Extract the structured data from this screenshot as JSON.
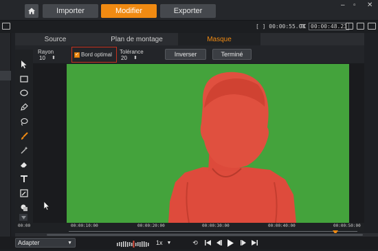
{
  "header": {
    "tabs": [
      {
        "label": "Importer"
      },
      {
        "label": "Modifier"
      },
      {
        "label": "Exporter"
      }
    ]
  },
  "timecode": {
    "duration": "[ ] 00:00:55.08",
    "tc_label": "TC",
    "current": "00:00:48.23"
  },
  "editor_tabs": [
    {
      "label": "Source"
    },
    {
      "label": "Plan de montage"
    },
    {
      "label": "Masque"
    }
  ],
  "options": {
    "radius_label": "Rayon",
    "radius_value": "10",
    "edge_label": "Bord optimal",
    "tolerance_label": "Tolérance",
    "tolerance_value": "20",
    "invert_label": "Inverser",
    "done_label": "Terminé"
  },
  "ruler": {
    "labels": [
      "00:00",
      "00:00:10:00",
      "00:00:20:00",
      "00:00:30:00",
      "00:00:40:00",
      "00:00:50:00"
    ]
  },
  "bottom": {
    "fit_label": "Adapter",
    "speed_label": "1x"
  },
  "colors": {
    "accent": "#f08a12",
    "chroma_green": "#44a33c",
    "mask_red": "#de4b3c"
  }
}
